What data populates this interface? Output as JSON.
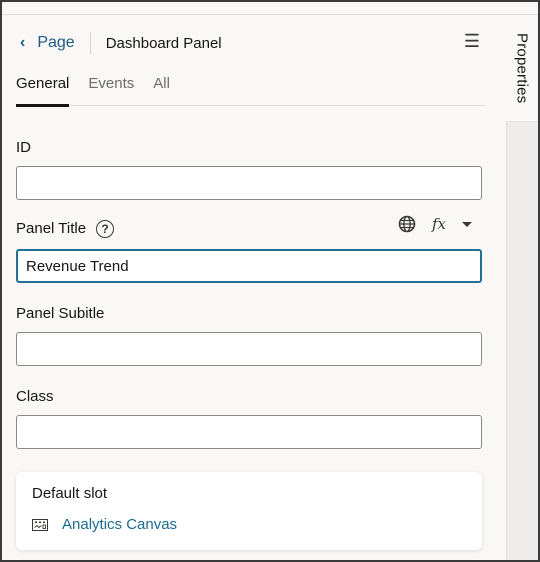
{
  "header": {
    "back_label": "Page",
    "title": "Dashboard Panel",
    "menu_icon": "hamburger-menu-icon"
  },
  "tabs": [
    {
      "label": "General",
      "active": true
    },
    {
      "label": "Events",
      "active": false
    },
    {
      "label": "All",
      "active": false
    }
  ],
  "side_panel": {
    "tab_label": "Properties"
  },
  "fields": {
    "id": {
      "label": "ID",
      "value": ""
    },
    "panel_title": {
      "label": "Panel Title",
      "value": "Revenue Trend",
      "help_icon": "?",
      "fx_label": "fx"
    },
    "panel_subtitle": {
      "label": "Panel Subitle",
      "value": ""
    },
    "class": {
      "label": "Class",
      "value": ""
    }
  },
  "default_slot": {
    "title": "Default slot",
    "item_label": "Analytics Canvas"
  },
  "colors": {
    "accent": "#227096",
    "link": "#1c6a90",
    "text": "#161513"
  }
}
